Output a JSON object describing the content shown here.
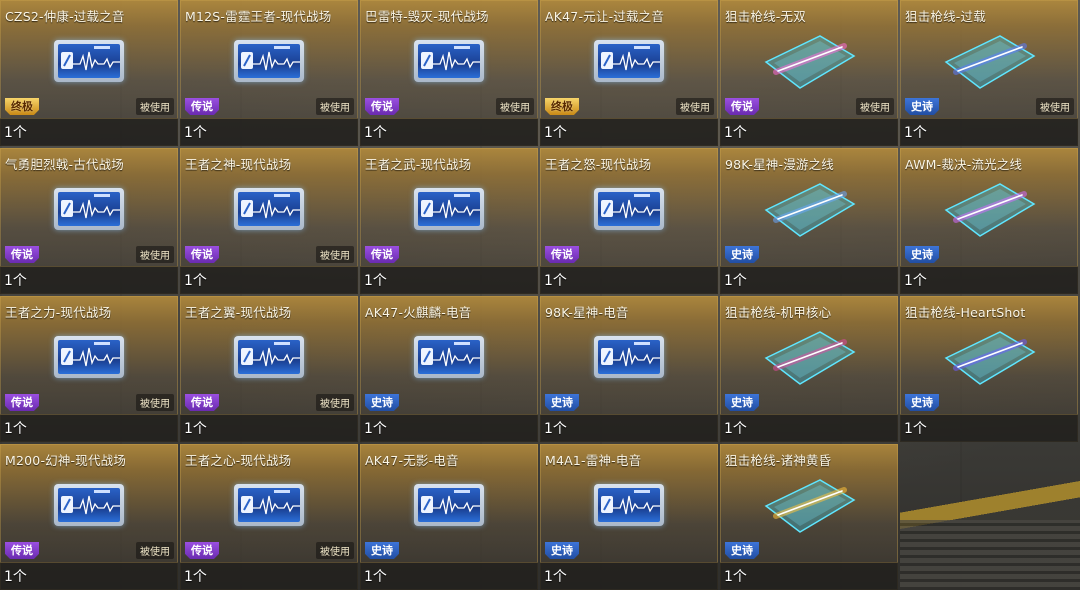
{
  "items": [
    {
      "name": "CZS2-仲康-过载之音",
      "rarity": "ultimate",
      "rarity_label": "终极",
      "type": "music",
      "count": "1个",
      "used": "被使用"
    },
    {
      "name": "M12S-雷霆王者-现代战场",
      "rarity": "legend",
      "rarity_label": "传说",
      "type": "music",
      "count": "1个",
      "used": "被使用"
    },
    {
      "name": "巴雷特-毁灭-现代战场",
      "rarity": "legend",
      "rarity_label": "传说",
      "type": "music",
      "count": "1个",
      "used": "被使用"
    },
    {
      "name": "AK47-元让-过载之音",
      "rarity": "ultimate",
      "rarity_label": "终极",
      "type": "music",
      "count": "1个",
      "used": "被使用"
    },
    {
      "name": "狙击枪线-无双",
      "rarity": "legend",
      "rarity_label": "传说",
      "type": "trail",
      "trail_color": "#ff6ad8",
      "count": "1个",
      "used": "被使用"
    },
    {
      "name": "狙击枪线-过载",
      "rarity": "epic",
      "rarity_label": "史诗",
      "type": "trail",
      "trail_color": "#5a7bff",
      "count": "1个",
      "used": "被使用"
    },
    {
      "name": "气勇胆烈戟-古代战场",
      "rarity": "legend",
      "rarity_label": "传说",
      "type": "music",
      "count": "1个",
      "used": "被使用"
    },
    {
      "name": "王者之神-现代战场",
      "rarity": "legend",
      "rarity_label": "传说",
      "type": "music",
      "count": "1个",
      "used": "被使用"
    },
    {
      "name": "王者之武-现代战场",
      "rarity": "legend",
      "rarity_label": "传说",
      "type": "music",
      "count": "1个",
      "used": ""
    },
    {
      "name": "王者之怒-现代战场",
      "rarity": "legend",
      "rarity_label": "传说",
      "type": "music",
      "count": "1个",
      "used": ""
    },
    {
      "name": "98K-星神-漫游之线",
      "rarity": "epic",
      "rarity_label": "史诗",
      "type": "trail",
      "trail_color": "#6aa8ff",
      "count": "1个",
      "used": ""
    },
    {
      "name": "AWM-裁决-流光之线",
      "rarity": "epic",
      "rarity_label": "史诗",
      "type": "trail",
      "trail_color": "#d46aff",
      "count": "1个",
      "used": ""
    },
    {
      "name": "王者之力-现代战场",
      "rarity": "legend",
      "rarity_label": "传说",
      "type": "music",
      "count": "1个",
      "used": "被使用"
    },
    {
      "name": "王者之翼-现代战场",
      "rarity": "legend",
      "rarity_label": "传说",
      "type": "music",
      "count": "1个",
      "used": "被使用"
    },
    {
      "name": "AK47-火麒麟-电音",
      "rarity": "epic",
      "rarity_label": "史诗",
      "type": "music",
      "count": "1个",
      "used": ""
    },
    {
      "name": "98K-星神-电音",
      "rarity": "epic",
      "rarity_label": "史诗",
      "type": "music",
      "count": "1个",
      "used": ""
    },
    {
      "name": "狙击枪线-机甲核心",
      "rarity": "epic",
      "rarity_label": "史诗",
      "type": "trail",
      "trail_color": "#e04aa0",
      "count": "1个",
      "used": ""
    },
    {
      "name": "狙击枪线-HeartShot",
      "rarity": "epic",
      "rarity_label": "史诗",
      "type": "trail",
      "trail_color": "#6a5cff",
      "count": "1个",
      "used": ""
    },
    {
      "name": "M200-幻神-现代战场",
      "rarity": "legend",
      "rarity_label": "传说",
      "type": "music",
      "count": "1个",
      "used": "被使用"
    },
    {
      "name": "王者之心-现代战场",
      "rarity": "legend",
      "rarity_label": "传说",
      "type": "music",
      "count": "1个",
      "used": "被使用"
    },
    {
      "name": "AK47-无影-电音",
      "rarity": "epic",
      "rarity_label": "史诗",
      "type": "music",
      "count": "1个",
      "used": ""
    },
    {
      "name": "M4A1-雷神-电音",
      "rarity": "epic",
      "rarity_label": "史诗",
      "type": "music",
      "count": "1个",
      "used": ""
    },
    {
      "name": "狙击枪线-诸神黄昏",
      "rarity": "epic",
      "rarity_label": "史诗",
      "type": "trail",
      "trail_color": "#ffc23a",
      "count": "1个",
      "used": ""
    }
  ]
}
